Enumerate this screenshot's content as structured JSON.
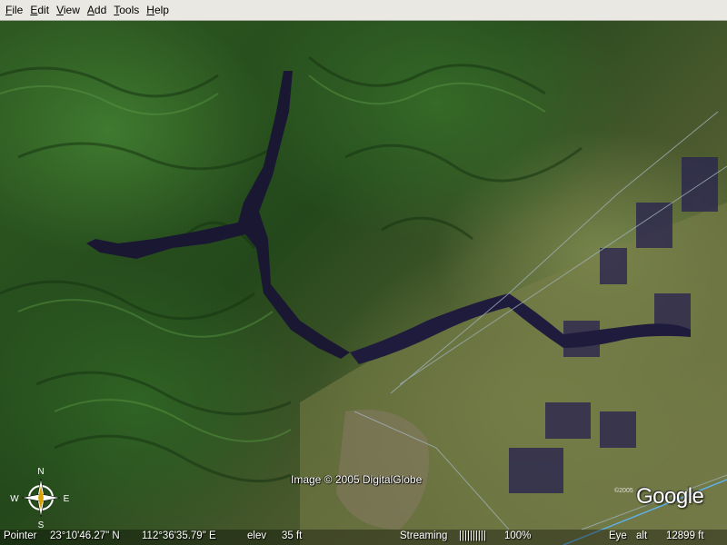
{
  "menu": {
    "items": [
      {
        "first": "F",
        "rest": "ile"
      },
      {
        "first": "E",
        "rest": "dit"
      },
      {
        "first": "V",
        "rest": "iew"
      },
      {
        "first": "A",
        "rest": "dd"
      },
      {
        "first": "T",
        "rest": "ools"
      },
      {
        "first": "H",
        "rest": "elp"
      }
    ]
  },
  "map": {
    "credit": "Image © 2005 DigitalGlobe",
    "logo": "Google",
    "logo_year": "©2005"
  },
  "compass": {
    "n": "N",
    "s": "S",
    "e": "E",
    "w": "W"
  },
  "status": {
    "pointer_label": "Pointer",
    "lat": "23°10'46.27\" N",
    "lon": "112°36'35.79\" E",
    "elev_label": "elev",
    "elev_value": "35 ft",
    "streaming_label": "Streaming",
    "streaming_bar": "||||||||||",
    "streaming_pct": "100%",
    "eye_label": "Eye",
    "alt_label": "alt",
    "alt_value": "12899 ft"
  },
  "colors": {
    "water": "#1a1733",
    "forest": "#2e5a22",
    "farmland": "#7a8048"
  }
}
